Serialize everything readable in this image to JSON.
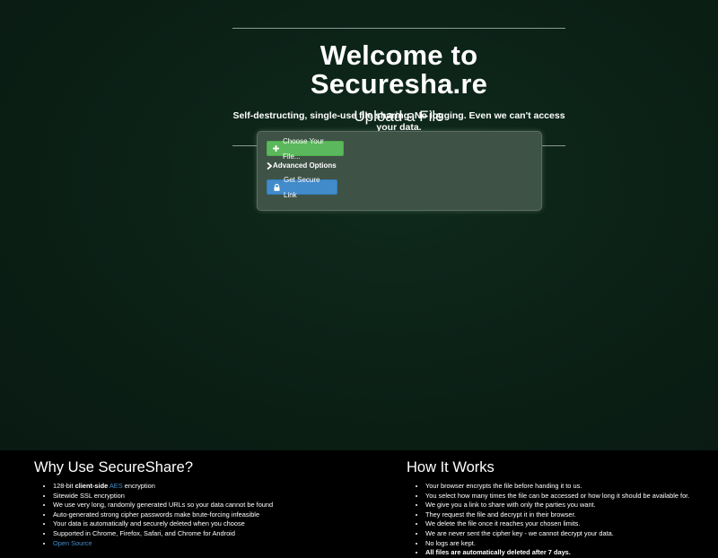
{
  "hero": {
    "title": "Welcome to Securesha.re",
    "tagline": "Self-destructing, single-use file sharing. No logging. Even we can't access your data."
  },
  "upload": {
    "title": "Upload a File",
    "choose_label": "Choose Your File...",
    "choose_icon": "plus-icon",
    "advanced_label": "Advanced Options",
    "advanced_icon": "chevron-right-icon",
    "submit_label": "Get Secure Link",
    "submit_icon": "lock-icon"
  },
  "why": {
    "title": "Why Use SecureShare?",
    "items": [
      {
        "pre": "128-bit ",
        "bold": "client-side",
        "mid": " ",
        "link": "AES",
        "post": " encryption"
      },
      "Sitewide SSL encryption",
      "We use very long, randomly generated URLs so your data cannot be found",
      "Auto-generated strong cipher passwords make brute-forcing infeasible",
      "Your data is automatically and securely deleted when you choose",
      "Supported in Chrome, Firefox, Safari, and Chrome for Android",
      "Open Source"
    ]
  },
  "how": {
    "title": "How It Works",
    "items": [
      "Your browser encrypts the file before handing it to us.",
      "You select how many times the file can be accessed or how long it should be available for.",
      "We give you a link to share with only the parties you want.",
      "They request the file and decrypt it in their browser.",
      "We delete the file once it reaches your chosen limits.",
      "We are never sent the cipher key - we cannot decrypt your data.",
      "No logs are kept.",
      "All files are automatically deleted after 7 days."
    ]
  },
  "colors": {
    "background": "#0b1e15",
    "success": "#5cb85c",
    "primary": "#428bca",
    "footer": "#000000"
  }
}
